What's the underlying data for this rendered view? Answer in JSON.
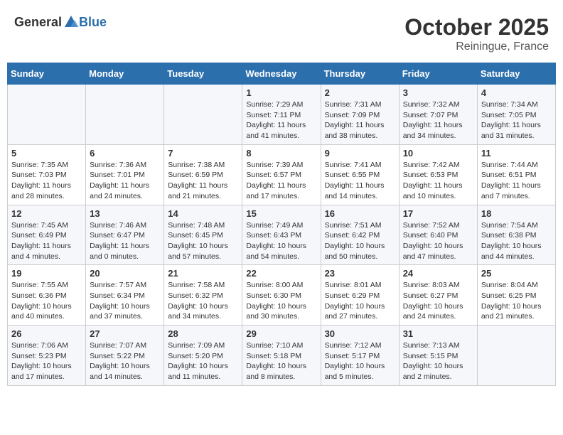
{
  "header": {
    "logo_general": "General",
    "logo_blue": "Blue",
    "month": "October 2025",
    "location": "Reiningue, France"
  },
  "days_of_week": [
    "Sunday",
    "Monday",
    "Tuesday",
    "Wednesday",
    "Thursday",
    "Friday",
    "Saturday"
  ],
  "weeks": [
    [
      {
        "day": "",
        "info": ""
      },
      {
        "day": "",
        "info": ""
      },
      {
        "day": "",
        "info": ""
      },
      {
        "day": "1",
        "info": "Sunrise: 7:29 AM\nSunset: 7:11 PM\nDaylight: 11 hours and 41 minutes."
      },
      {
        "day": "2",
        "info": "Sunrise: 7:31 AM\nSunset: 7:09 PM\nDaylight: 11 hours and 38 minutes."
      },
      {
        "day": "3",
        "info": "Sunrise: 7:32 AM\nSunset: 7:07 PM\nDaylight: 11 hours and 34 minutes."
      },
      {
        "day": "4",
        "info": "Sunrise: 7:34 AM\nSunset: 7:05 PM\nDaylight: 11 hours and 31 minutes."
      }
    ],
    [
      {
        "day": "5",
        "info": "Sunrise: 7:35 AM\nSunset: 7:03 PM\nDaylight: 11 hours and 28 minutes."
      },
      {
        "day": "6",
        "info": "Sunrise: 7:36 AM\nSunset: 7:01 PM\nDaylight: 11 hours and 24 minutes."
      },
      {
        "day": "7",
        "info": "Sunrise: 7:38 AM\nSunset: 6:59 PM\nDaylight: 11 hours and 21 minutes."
      },
      {
        "day": "8",
        "info": "Sunrise: 7:39 AM\nSunset: 6:57 PM\nDaylight: 11 hours and 17 minutes."
      },
      {
        "day": "9",
        "info": "Sunrise: 7:41 AM\nSunset: 6:55 PM\nDaylight: 11 hours and 14 minutes."
      },
      {
        "day": "10",
        "info": "Sunrise: 7:42 AM\nSunset: 6:53 PM\nDaylight: 11 hours and 10 minutes."
      },
      {
        "day": "11",
        "info": "Sunrise: 7:44 AM\nSunset: 6:51 PM\nDaylight: 11 hours and 7 minutes."
      }
    ],
    [
      {
        "day": "12",
        "info": "Sunrise: 7:45 AM\nSunset: 6:49 PM\nDaylight: 11 hours and 4 minutes."
      },
      {
        "day": "13",
        "info": "Sunrise: 7:46 AM\nSunset: 6:47 PM\nDaylight: 11 hours and 0 minutes."
      },
      {
        "day": "14",
        "info": "Sunrise: 7:48 AM\nSunset: 6:45 PM\nDaylight: 10 hours and 57 minutes."
      },
      {
        "day": "15",
        "info": "Sunrise: 7:49 AM\nSunset: 6:43 PM\nDaylight: 10 hours and 54 minutes."
      },
      {
        "day": "16",
        "info": "Sunrise: 7:51 AM\nSunset: 6:42 PM\nDaylight: 10 hours and 50 minutes."
      },
      {
        "day": "17",
        "info": "Sunrise: 7:52 AM\nSunset: 6:40 PM\nDaylight: 10 hours and 47 minutes."
      },
      {
        "day": "18",
        "info": "Sunrise: 7:54 AM\nSunset: 6:38 PM\nDaylight: 10 hours and 44 minutes."
      }
    ],
    [
      {
        "day": "19",
        "info": "Sunrise: 7:55 AM\nSunset: 6:36 PM\nDaylight: 10 hours and 40 minutes."
      },
      {
        "day": "20",
        "info": "Sunrise: 7:57 AM\nSunset: 6:34 PM\nDaylight: 10 hours and 37 minutes."
      },
      {
        "day": "21",
        "info": "Sunrise: 7:58 AM\nSunset: 6:32 PM\nDaylight: 10 hours and 34 minutes."
      },
      {
        "day": "22",
        "info": "Sunrise: 8:00 AM\nSunset: 6:30 PM\nDaylight: 10 hours and 30 minutes."
      },
      {
        "day": "23",
        "info": "Sunrise: 8:01 AM\nSunset: 6:29 PM\nDaylight: 10 hours and 27 minutes."
      },
      {
        "day": "24",
        "info": "Sunrise: 8:03 AM\nSunset: 6:27 PM\nDaylight: 10 hours and 24 minutes."
      },
      {
        "day": "25",
        "info": "Sunrise: 8:04 AM\nSunset: 6:25 PM\nDaylight: 10 hours and 21 minutes."
      }
    ],
    [
      {
        "day": "26",
        "info": "Sunrise: 7:06 AM\nSunset: 5:23 PM\nDaylight: 10 hours and 17 minutes."
      },
      {
        "day": "27",
        "info": "Sunrise: 7:07 AM\nSunset: 5:22 PM\nDaylight: 10 hours and 14 minutes."
      },
      {
        "day": "28",
        "info": "Sunrise: 7:09 AM\nSunset: 5:20 PM\nDaylight: 10 hours and 11 minutes."
      },
      {
        "day": "29",
        "info": "Sunrise: 7:10 AM\nSunset: 5:18 PM\nDaylight: 10 hours and 8 minutes."
      },
      {
        "day": "30",
        "info": "Sunrise: 7:12 AM\nSunset: 5:17 PM\nDaylight: 10 hours and 5 minutes."
      },
      {
        "day": "31",
        "info": "Sunrise: 7:13 AM\nSunset: 5:15 PM\nDaylight: 10 hours and 2 minutes."
      },
      {
        "day": "",
        "info": ""
      }
    ]
  ]
}
